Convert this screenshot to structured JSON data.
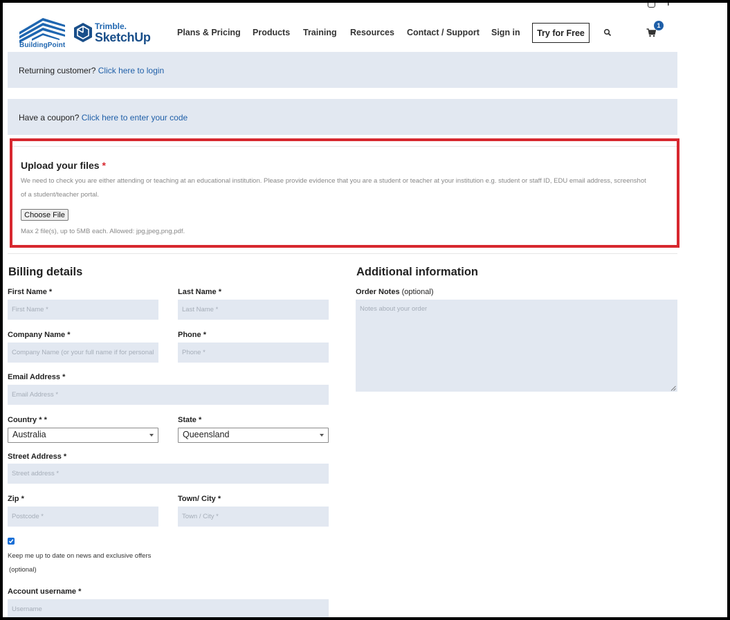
{
  "header": {
    "brand_buildingpoint": "BuildingPoint",
    "brand_trimble": "Trimble.",
    "brand_sketchup": "SketchUp",
    "nav": [
      "Plans & Pricing",
      "Products",
      "Training",
      "Resources",
      "Contact / Support",
      "Sign in"
    ],
    "try_label": "Try for Free",
    "cart_count": "1",
    "icons": [
      "instagram-icon",
      "facebook-icon",
      "search-icon",
      "cart-icon"
    ]
  },
  "notices": {
    "returning_text": "Returning customer?",
    "returning_link": "Click here to login",
    "coupon_text": "Have a coupon?",
    "coupon_link": "Click here to enter your code"
  },
  "upload": {
    "title": "Upload your files",
    "required_mark": "*",
    "description": "We need to check you are either attending or teaching at an educational institution. Please provide evidence that you are a student or teacher at your institution e.g. student or staff ID, EDU email address, screenshot of a student/teacher portal.",
    "button_label": "Choose File",
    "hint": "Max 2 file(s), up to 5MB each. Allowed: jpg,jpeg,png,pdf."
  },
  "billing": {
    "title": "Billing details",
    "first_name": {
      "label": "First Name",
      "req": "*",
      "placeholder": "First Name *"
    },
    "last_name": {
      "label": "Last Name",
      "req": "*",
      "placeholder": "Last Name *"
    },
    "company": {
      "label": "Company Name",
      "req": "*",
      "placeholder": "Company Name (or your full name if for personal use) *"
    },
    "phone": {
      "label": "Phone",
      "req": "*",
      "placeholder": "Phone *"
    },
    "email": {
      "label": "Email Address",
      "req": "*",
      "placeholder": "Email Address *"
    },
    "country": {
      "label": "Country",
      "req": "* *",
      "value": "Australia"
    },
    "state": {
      "label": "State",
      "req": "*",
      "value": "Queensland"
    },
    "street": {
      "label": "Street Address",
      "req": "*",
      "placeholder": "Street address *"
    },
    "zip": {
      "label": "Zip",
      "req": "*",
      "placeholder": "Postcode *"
    },
    "city": {
      "label": "Town/ City",
      "req": "*",
      "placeholder": "Town / City *"
    },
    "newsletter_label": "Keep me up to date on news and exclusive offers",
    "newsletter_optional": "(optional)",
    "newsletter_checked": true,
    "username": {
      "label": "Account username",
      "req": "*",
      "placeholder": "Username"
    }
  },
  "additional": {
    "title": "Additional information",
    "notes_label": "Order Notes",
    "notes_optional": "(optional)",
    "notes_placeholder": "Notes about your order"
  },
  "colors": {
    "accent_blue": "#1f5fa8",
    "highlight_red": "#d7282f",
    "field_bg": "#e2e8f1"
  }
}
